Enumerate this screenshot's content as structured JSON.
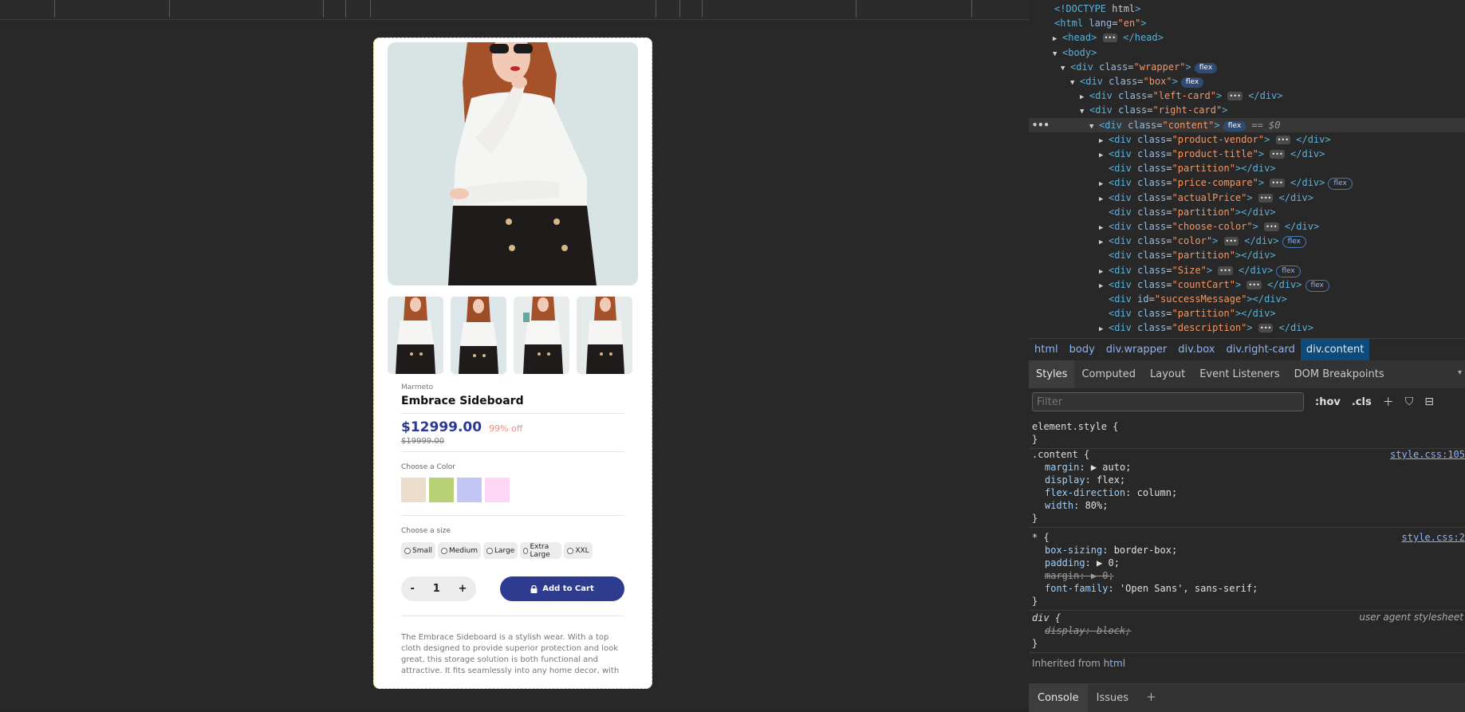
{
  "product": {
    "vendor": "Marmeto",
    "title": "Embrace Sideboard",
    "price": "$12999.00",
    "discount": "99% off",
    "compare_price": "$19999.00",
    "choose_color_label": "Choose a Color",
    "colors": [
      "#ecdecb",
      "#b6d274",
      "#c2c6f4",
      "#fed7f7"
    ],
    "choose_size_label": "Choose a size",
    "sizes": [
      "Small",
      "Medium",
      "Large",
      "Extra Large",
      "XXL"
    ],
    "quantity": "1",
    "minus": "-",
    "plus": "+",
    "add_to_cart": "Add to Cart",
    "description": "The Embrace Sideboard is a stylish wear. With a top cloth designed to provide superior protection and look great, this storage solution is both functional and attractive. It fits seamlessly into any home decor, with"
  },
  "devtools": {
    "dom_lines": [
      {
        "t": "<!DOCTYPE html>"
      },
      {
        "t": "<html lang=\"en\">"
      },
      {
        "t": "<head> … </head>"
      },
      {
        "t": "<body>"
      },
      {
        "t": "<div class=\"wrapper\">",
        "badge": "flex"
      },
      {
        "t": "<div class=\"box\">",
        "badge": "flex"
      },
      {
        "t": "<div class=\"left-card\"> … </div>"
      },
      {
        "t": "<div class=\"right-card\">"
      },
      {
        "t": "<div class=\"content\">",
        "badge": "flex",
        "suffix": "== $0"
      },
      {
        "t": "<div class=\"product-vendor\"> … </div>"
      },
      {
        "t": "<div class=\"product-title\"> … </div>"
      },
      {
        "t": "<div class=\"partition\"></div>"
      },
      {
        "t": "<div class=\"price-compare\"> … </div>",
        "badge": "flex"
      },
      {
        "t": "<div class=\"actualPrice\"> … </div>"
      },
      {
        "t": "<div class=\"partition\"></div>"
      },
      {
        "t": "<div class=\"choose-color\"> … </div>"
      },
      {
        "t": "<div class=\"color\"> … </div>",
        "badge": "flex"
      },
      {
        "t": "<div class=\"partition\"></div>"
      },
      {
        "t": "<div class=\"Size\"> … </div>",
        "badge": "flex"
      },
      {
        "t": "<div class=\"countCart\"> … </div>",
        "badge": "flex"
      },
      {
        "t": "<div id=\"successMessage\"></div>"
      },
      {
        "t": "<div class=\"partition\"></div>"
      },
      {
        "t": "<div class=\"description\"> … </div>"
      }
    ],
    "breadcrumbs": [
      "html",
      "body",
      "div.wrapper",
      "div.box",
      "div.right-card",
      "div.content"
    ],
    "panel_tabs": [
      "Styles",
      "Computed",
      "Layout",
      "Event Listeners",
      "DOM Breakpoints"
    ],
    "filter_placeholder": "Filter",
    "hov": ":hov",
    "cls": ".cls",
    "styles": {
      "element_style": "element.style {",
      "close": "}",
      "content_selector": ".content {",
      "content_source": "style.css:105",
      "content_props": [
        {
          "p": "margin",
          "v": "▶ auto;"
        },
        {
          "p": "display",
          "v": "flex;"
        },
        {
          "p": "flex-direction",
          "v": "column;"
        },
        {
          "p": "width",
          "v": "80%;"
        }
      ],
      "star_selector": "* {",
      "star_source": "style.css:2",
      "star_props": [
        {
          "p": "box-sizing",
          "v": "border-box;"
        },
        {
          "p": "padding",
          "v": "▶ 0;"
        },
        {
          "p": "margin",
          "v": "▶ 0;",
          "struck": true
        },
        {
          "p": "font-family",
          "v": "'Open Sans', sans-serif;"
        }
      ],
      "div_selector": "div {",
      "ua_label": "user agent stylesheet",
      "div_prop": "display: block;",
      "inherited_label": "Inherited from",
      "inherited_from": "html"
    },
    "drawer_tabs": [
      "Console",
      "Issues"
    ]
  }
}
